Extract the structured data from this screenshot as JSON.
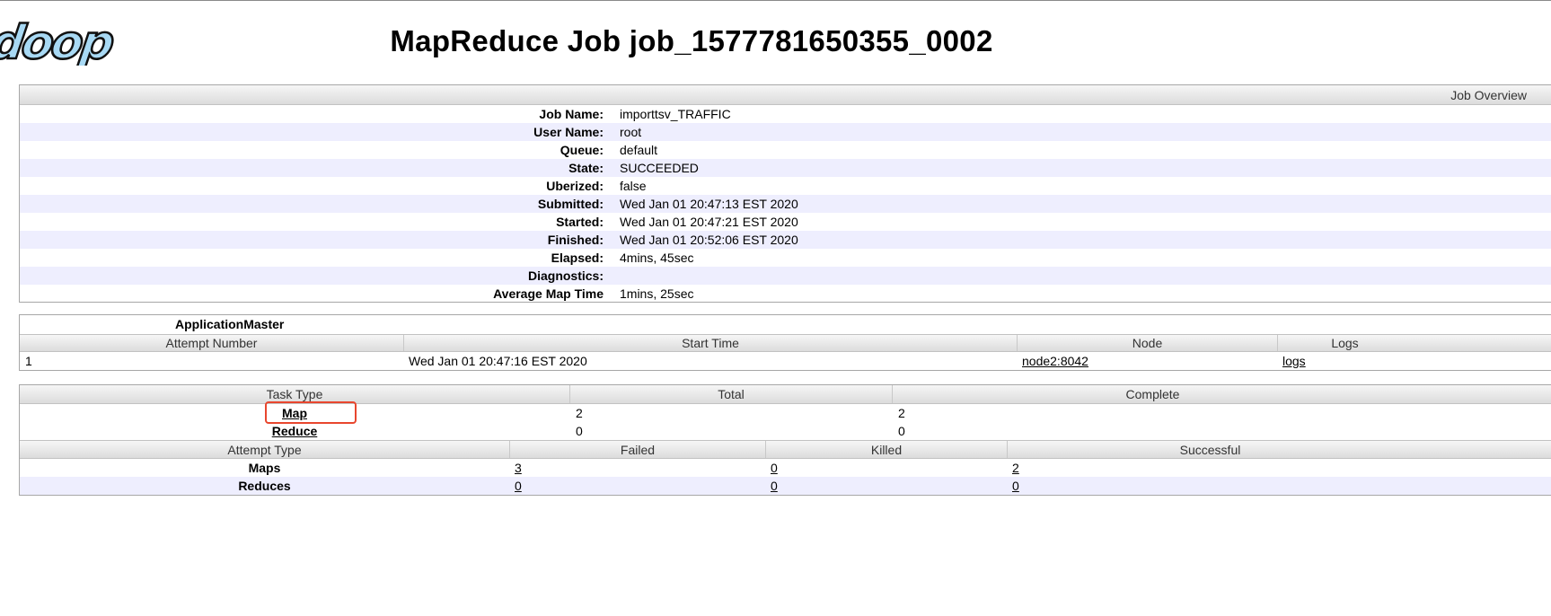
{
  "header": {
    "logo_text": "doop",
    "title": "MapReduce Job job_1577781650355_0002"
  },
  "overview": {
    "title": "Job Overview",
    "rows": [
      {
        "label": "Job Name:",
        "value": "importtsv_TRAFFIC"
      },
      {
        "label": "User Name:",
        "value": "root"
      },
      {
        "label": "Queue:",
        "value": "default"
      },
      {
        "label": "State:",
        "value": "SUCCEEDED"
      },
      {
        "label": "Uberized:",
        "value": "false"
      },
      {
        "label": "Submitted:",
        "value": "Wed Jan 01 20:47:13 EST 2020"
      },
      {
        "label": "Started:",
        "value": "Wed Jan 01 20:47:21 EST 2020"
      },
      {
        "label": "Finished:",
        "value": "Wed Jan 01 20:52:06 EST 2020"
      },
      {
        "label": "Elapsed:",
        "value": "4mins, 45sec"
      },
      {
        "label": "Diagnostics:",
        "value": ""
      },
      {
        "label": "Average Map Time",
        "value": "1mins, 25sec"
      }
    ]
  },
  "application_master": {
    "caption": "ApplicationMaster",
    "headers": {
      "attempt_number": "Attempt Number",
      "start_time": "Start Time",
      "node": "Node",
      "logs": "Logs"
    },
    "rows": [
      {
        "attempt_number": "1",
        "start_time": "Wed Jan 01 20:47:16 EST 2020",
        "node": "node2:8042",
        "logs": "logs"
      }
    ]
  },
  "tasks": {
    "headers": {
      "task_type": "Task Type",
      "total": "Total",
      "complete": "Complete"
    },
    "rows": [
      {
        "task_type": "Map",
        "total": "2",
        "complete": "2"
      },
      {
        "task_type": "Reduce",
        "total": "0",
        "complete": "0"
      }
    ]
  },
  "attempts": {
    "headers": {
      "attempt_type": "Attempt Type",
      "failed": "Failed",
      "killed": "Killed",
      "successful": "Successful"
    },
    "rows": [
      {
        "attempt_type": "Maps",
        "failed": "3",
        "killed": "0",
        "successful": "2"
      },
      {
        "attempt_type": "Reduces",
        "failed": "0",
        "killed": "0",
        "successful": "0"
      }
    ]
  },
  "colors": {
    "alt_row": "#eeeefe",
    "highlight": "#e8462e",
    "logo_fill": "#a8d9f4"
  }
}
